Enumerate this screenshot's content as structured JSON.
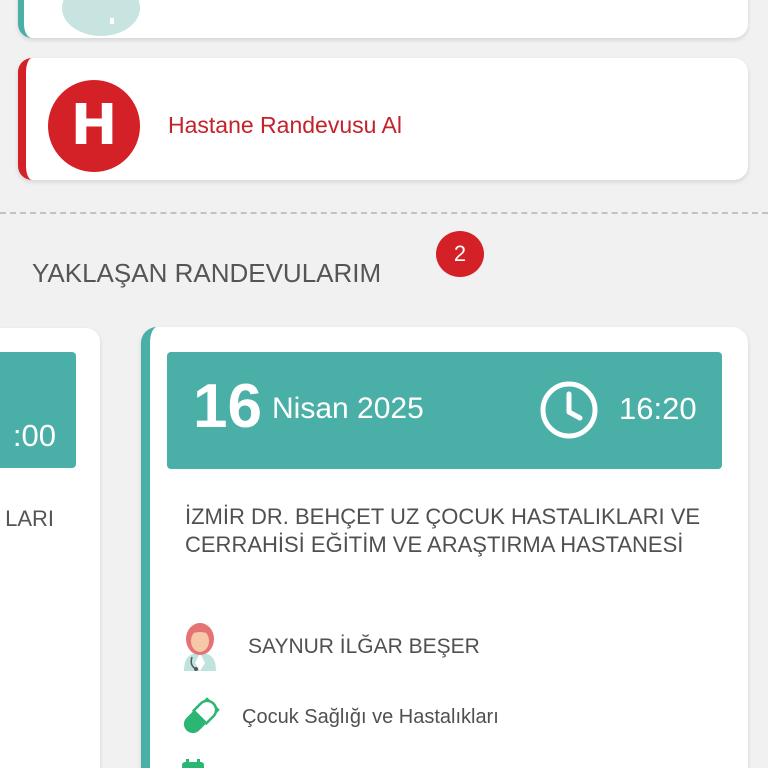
{
  "hospital_appointment": {
    "icon_letter": "H",
    "label": "Hastane Randevusu Al"
  },
  "upcoming": {
    "title": "YAKLAŞAN RANDEVULARIM",
    "count": "2"
  },
  "previous_card": {
    "time_partial": ":00",
    "hospital_partial": "LARI"
  },
  "appointment": {
    "day": "16",
    "month_year": "Nisan 2025",
    "time": "16:20",
    "hospital": "İZMİR DR. BEHÇET UZ ÇOCUK HASTALIKLARI VE CERRAHİSİ EĞİTİM VE ARAŞTIRMA HASTANESİ",
    "doctor": "SAYNUR İLĞAR BEŞER",
    "department": "Çocuk Sağlığı ve Hastalıkları"
  },
  "colors": {
    "accent_teal": "#4aafa6",
    "brand_red": "#d42027"
  },
  "icons": {
    "hospital": "hospital-h-icon",
    "clock": "clock-icon",
    "doctor": "female-doctor-icon",
    "department": "pill-icon",
    "calendar": "calendar-icon"
  }
}
